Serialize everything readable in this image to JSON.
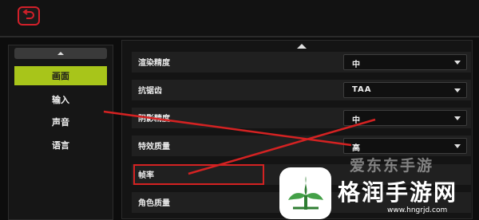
{
  "nav": {
    "items": [
      {
        "label": "画面",
        "active": true
      },
      {
        "label": "输入",
        "active": false
      },
      {
        "label": "声音",
        "active": false
      },
      {
        "label": "语言",
        "active": false
      }
    ]
  },
  "settings": [
    {
      "label": "渲染精度",
      "value": "中"
    },
    {
      "label": "抗锯齿",
      "value": "TAA"
    },
    {
      "label": "阴影精度",
      "value": "中"
    },
    {
      "label": "特效质量",
      "value": "高"
    },
    {
      "label": "帧率",
      "value": ""
    },
    {
      "label": "角色质量",
      "value": ""
    }
  ],
  "watermark": {
    "top_text": "爱东东手游",
    "brand": "格润手游网",
    "url": "www.hngrjd.com"
  },
  "colors": {
    "accent": "#a8c51a",
    "back_border": "#d2202a",
    "annotation": "#d42222"
  }
}
